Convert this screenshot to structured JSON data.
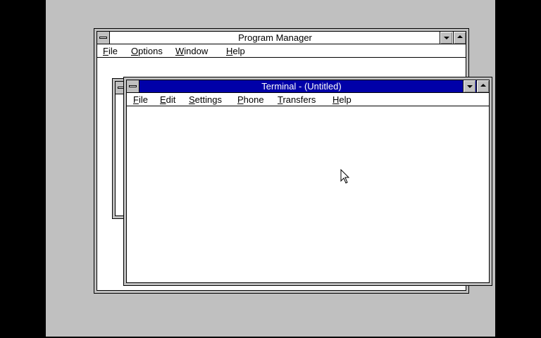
{
  "program_manager": {
    "title": "Program Manager",
    "menu": [
      {
        "key": "F",
        "rest": "ile"
      },
      {
        "key": "O",
        "rest": "ptions"
      },
      {
        "key": "W",
        "rest": "indow"
      },
      {
        "key": "H",
        "rest": "elp"
      }
    ]
  },
  "terminal": {
    "title": "Terminal - (Untitled)",
    "menu": [
      {
        "key": "F",
        "rest": "ile"
      },
      {
        "key": "E",
        "rest": "dit"
      },
      {
        "key": "S",
        "rest": "ettings"
      },
      {
        "key": "P",
        "rest": "hone"
      },
      {
        "key": "T",
        "rest": "ransfers"
      },
      {
        "key": "H",
        "rest": "elp"
      }
    ]
  },
  "colors": {
    "desktop": "#c0c0c0",
    "active_title": "#0000a8",
    "background": "#000000"
  },
  "icons": [
    "system-menu-icon",
    "minimize-arrow-icon",
    "maximize-arrow-icon",
    "mouse-pointer-icon"
  ]
}
